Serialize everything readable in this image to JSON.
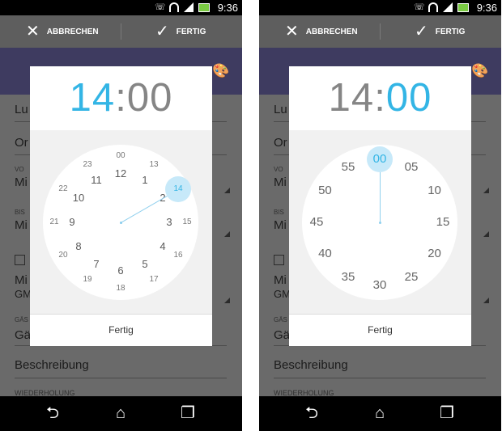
{
  "status_bar": {
    "time": "9:36"
  },
  "action_bar": {
    "cancel_label": "ABBRECHEN",
    "done_label": "FERTIG"
  },
  "form": {
    "title_fragment": "Lu",
    "location_fragment": "Or",
    "from_label_fragment": "VO",
    "from_value_fragment": "Mi",
    "to_label_fragment": "BIS",
    "to_value_fragment": "Mi",
    "timezone_fragment_1": "Mi",
    "timezone_fragment_2": "GM",
    "guests_label_fragment": "GÄS",
    "guests_value_fragment": "Gä",
    "description_placeholder": "Beschreibung",
    "repeat_label_fragment": "WIEDERHOLUNG"
  },
  "left_dialog": {
    "mode": "hours",
    "hour": "14",
    "separator": ":",
    "minute": "00",
    "selected_value": "14",
    "outer_numbers": [
      "12",
      "1",
      "2",
      "3",
      "4",
      "5",
      "6",
      "7",
      "8",
      "9",
      "10",
      "11"
    ],
    "inner_numbers": [
      "00",
      "13",
      "14",
      "15",
      "16",
      "17",
      "18",
      "19",
      "20",
      "21",
      "22",
      "23"
    ],
    "done_label": "Fertig"
  },
  "right_dialog": {
    "mode": "minutes",
    "hour": "14",
    "separator": ":",
    "minute": "00",
    "selected_value": "00",
    "minute_numbers": [
      "00",
      "05",
      "10",
      "15",
      "20",
      "25",
      "30",
      "35",
      "40",
      "45",
      "50",
      "55"
    ],
    "done_label": "Fertig"
  },
  "colors": {
    "accent": "#33b5e5",
    "selection_circle": "#c7e9f9",
    "action_bar": "#5e5e5e",
    "event_color_strip": "#3e3b60",
    "dialog_body": "#f1f1f1"
  },
  "icons": {
    "cancel": "close-x-icon",
    "done": "checkmark-icon",
    "palette": "palette-icon",
    "nav_back": "back-icon",
    "nav_home": "home-icon",
    "nav_recent": "recent-apps-icon"
  }
}
